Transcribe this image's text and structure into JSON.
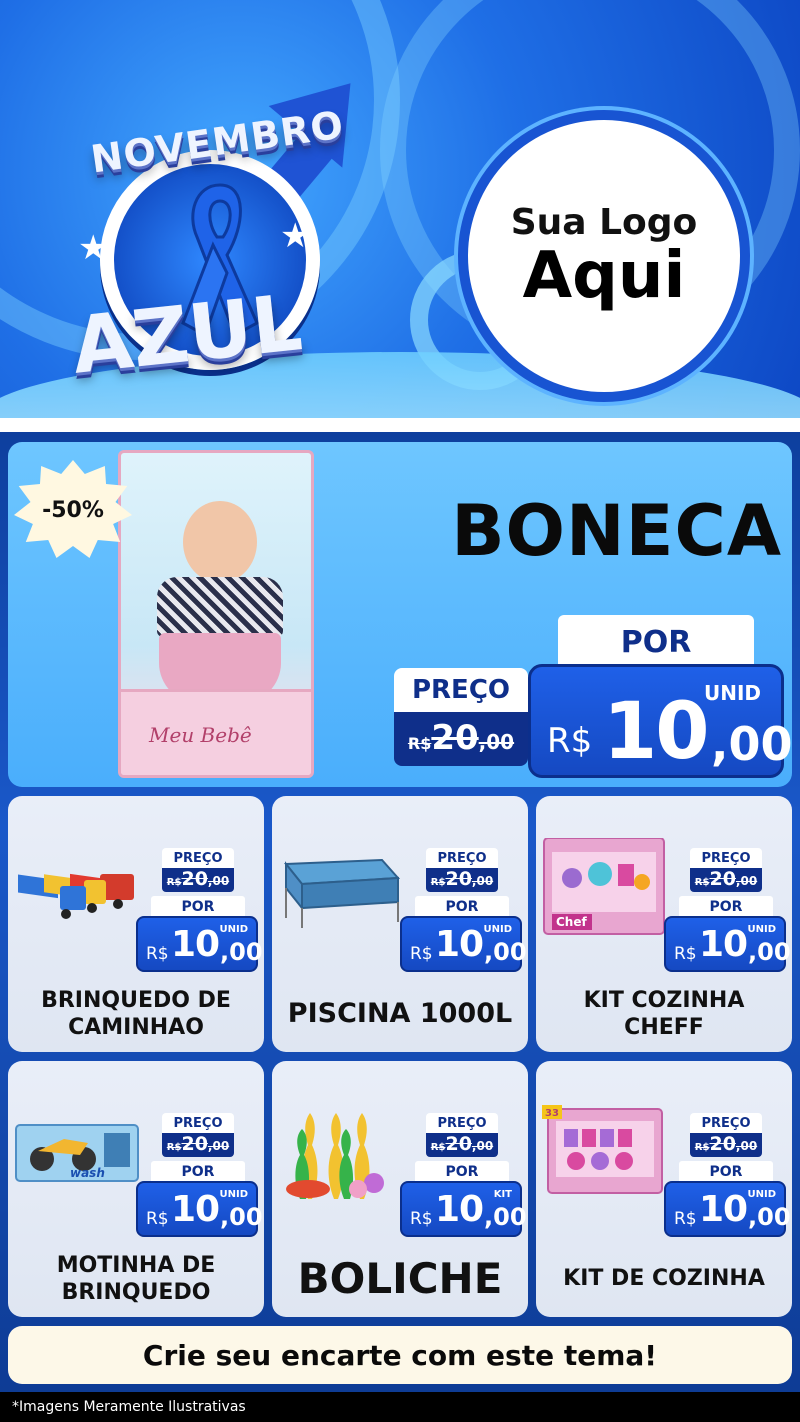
{
  "header": {
    "badge_top": "NOVEMBRO",
    "badge_bottom": "AZUL",
    "logo_line1": "Sua Logo",
    "logo_line2": "Aqui"
  },
  "featured": {
    "discount": "-50%",
    "title": "BONECA",
    "box_brand": "Meu Bebê",
    "por_label": "POR",
    "preco_label": "PREÇO",
    "old_currency": "R$",
    "old_int": "20",
    "old_dec": ",00",
    "unit": "UNID",
    "currency": "R$",
    "price_int": "10",
    "price_dec": ",00"
  },
  "products": [
    {
      "name": "BRINQUEDO DE CAMINHAO",
      "preco_label": "PREÇO",
      "old_currency": "R$",
      "old_int": "20",
      "old_dec": ",00",
      "por_label": "POR",
      "unit": "UNID",
      "currency": "R$",
      "price_int": "10",
      "price_dec": ",00"
    },
    {
      "name": "PISCINA 1000L",
      "preco_label": "PREÇO",
      "old_currency": "R$",
      "old_int": "20",
      "old_dec": ",00",
      "por_label": "POR",
      "unit": "UNID",
      "currency": "R$",
      "price_int": "10",
      "price_dec": ",00"
    },
    {
      "name": "KIT COZINHA CHEFF",
      "preco_label": "PREÇO",
      "old_currency": "R$",
      "old_int": "20",
      "old_dec": ",00",
      "por_label": "POR",
      "unit": "UNID",
      "currency": "R$",
      "price_int": "10",
      "price_dec": ",00",
      "thumb_text": "Chef"
    },
    {
      "name": "MOTINHA DE BRINQUEDO",
      "preco_label": "PREÇO",
      "old_currency": "R$",
      "old_int": "20",
      "old_dec": ",00",
      "por_label": "POR",
      "unit": "UNID",
      "currency": "R$",
      "price_int": "10",
      "price_dec": ",00",
      "thumb_text": "wash"
    },
    {
      "name": "BOLICHE",
      "preco_label": "PREÇO",
      "old_currency": "R$",
      "old_int": "20",
      "old_dec": ",00",
      "por_label": "POR",
      "unit": "KIT",
      "currency": "R$",
      "price_int": "10",
      "price_dec": ",00"
    },
    {
      "name": "KIT DE COZINHA",
      "preco_label": "PREÇO",
      "old_currency": "R$",
      "old_int": "20",
      "old_dec": ",00",
      "por_label": "POR",
      "unit": "UNID",
      "currency": "R$",
      "price_int": "10",
      "price_dec": ",00",
      "thumb_text": "33"
    }
  ],
  "footer": {
    "cta": "Crie seu encarte com este tema!",
    "disclaimer": "*Imagens Meramente Ilustrativas"
  },
  "colors": {
    "primary_blue": "#1549c2",
    "navy": "#0f2f8a",
    "light_blue": "#4aaefc",
    "card_bg": "#e9eef8",
    "cta_bg": "#fdf8e8"
  },
  "icons": [
    "blue-ribbon-icon",
    "male-symbol-arrow-icon",
    "star-icon"
  ]
}
